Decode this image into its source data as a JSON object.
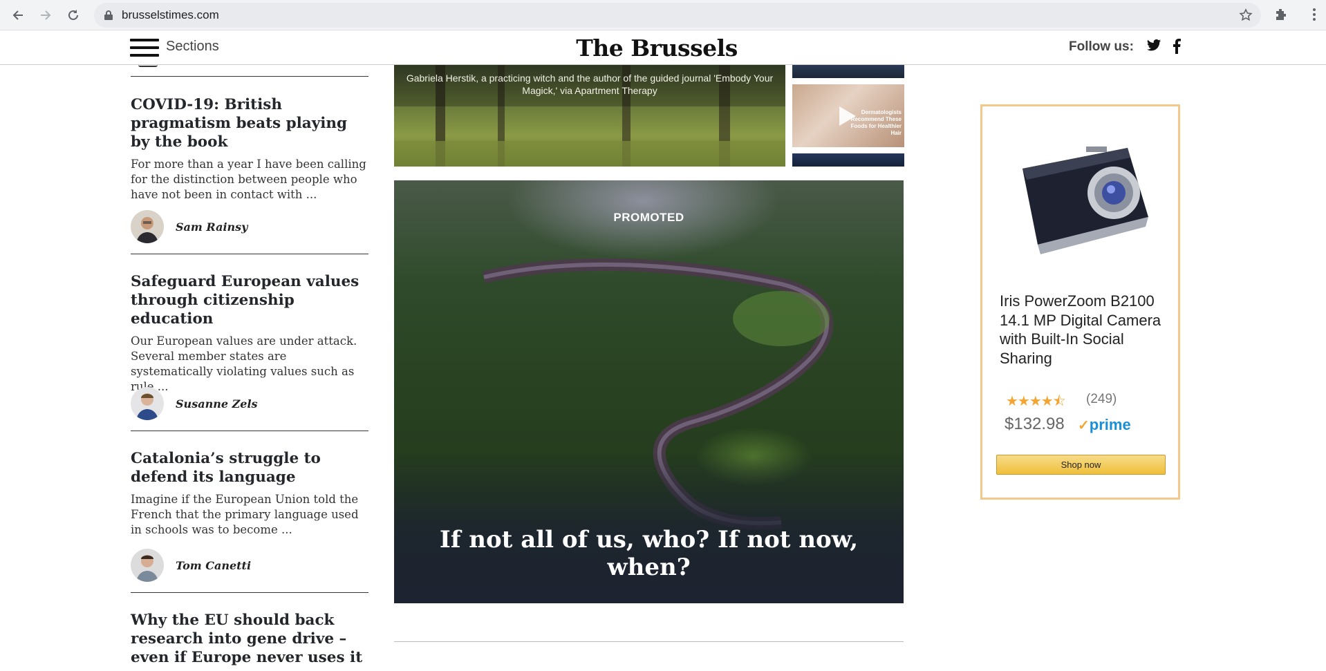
{
  "browser": {
    "url": "brusselstimes.com"
  },
  "header": {
    "sections_label": "Sections",
    "masthead": "The Brussels Times",
    "follow_label": "Follow us:"
  },
  "articles": [
    {
      "title": "COVID-19: British pragmatism beats playing by the book",
      "excerpt": "For more than a year I have been calling for the distinction between people who have not been in contact with ...",
      "author": "Sam Rainsy"
    },
    {
      "title": "Safeguard European values through citizenship education",
      "excerpt": "Our European values are under attack. Several member states are systematically violating values such as rule ...",
      "author": "Susanne Zels"
    },
    {
      "title": "Catalonia’s struggle to defend its language",
      "excerpt": "Imagine if the European Union told the French that the primary language used in schools was to become ...",
      "author": "Tom Canetti"
    },
    {
      "title": "Why the EU should back research into gene drive – even if Europe never uses it"
    }
  ],
  "video": {
    "caption": "Gabriela Herstik, a practicing witch and the author of the guided journal 'Embody Your Magick,' via Apartment Therapy",
    "thumb_text": "Dermatologists Recommend These Foods for Healthier Hair"
  },
  "promo": {
    "label": "PROMOTED",
    "title": "If not all of us, who? If not now, when?"
  },
  "ad": {
    "title": "Iris PowerZoom B2100 14.1 MP Digital Camera with Built-In Social Sharing",
    "rating_stars": "★★★★⯪",
    "rating": 4.5,
    "review_count": "(249)",
    "price": "$132.98",
    "prime": "prime",
    "button": "Shop now"
  },
  "colors": {
    "ad_border": "#f3c88a",
    "prime_blue": "#1a8fd6",
    "star_orange": "#f2a532"
  },
  "icons": [
    "back-icon",
    "forward-icon",
    "reload-icon",
    "lock-icon",
    "star-icon",
    "extensions-icon",
    "menu-icon",
    "twitter-icon",
    "facebook-icon",
    "play-icon"
  ]
}
